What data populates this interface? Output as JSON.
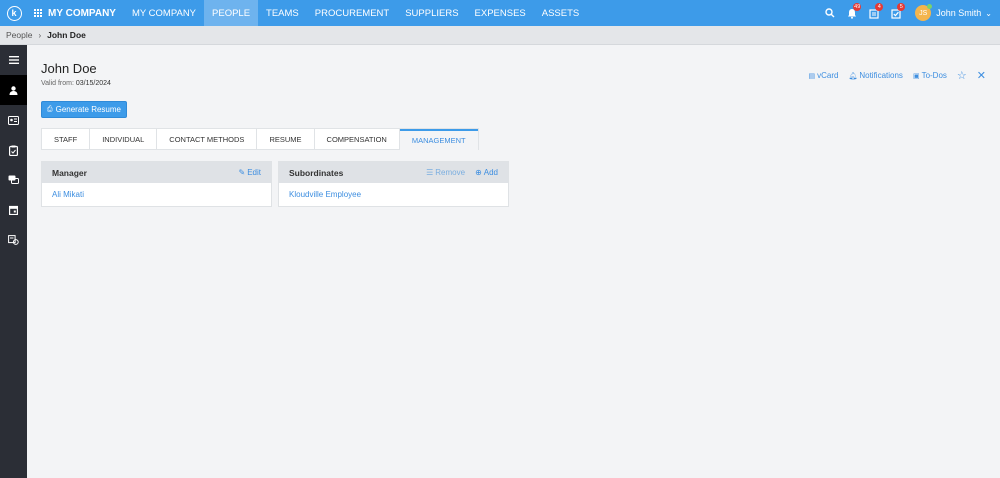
{
  "topnav": {
    "brand": "MY COMPANY",
    "items": [
      "MY COMPANY",
      "PEOPLE",
      "TEAMS",
      "PROCUREMENT",
      "SUPPLIERS",
      "EXPENSES",
      "ASSETS"
    ],
    "notifications_count": "49",
    "tasks_count": "4",
    "todos_count": "5",
    "avatar_initials": "JS",
    "user_name": "John Smith"
  },
  "breadcrumb": {
    "parent": "People",
    "current": "John Doe"
  },
  "page": {
    "title": "John Doe",
    "valid_from_label": "Valid from:",
    "valid_from_value": "03/15/2024",
    "generate_resume": "Generate Resume"
  },
  "actions": {
    "vcard": "vCard",
    "notifications": "Notifications",
    "todos": "To-Dos"
  },
  "tabs": [
    "STAFF",
    "INDIVIDUAL",
    "CONTACT METHODS",
    "RESUME",
    "COMPENSATION",
    "MANAGEMENT"
  ],
  "manager_panel": {
    "title": "Manager",
    "edit": "Edit",
    "value": "Ali Mikati"
  },
  "subordinates_panel": {
    "title": "Subordinates",
    "remove": "Remove",
    "add": "Add",
    "value": "Kloudville Employee"
  },
  "colors": {
    "primary": "#3d9be9",
    "link": "#3d8ee0",
    "sidebar": "#2b2e36"
  }
}
